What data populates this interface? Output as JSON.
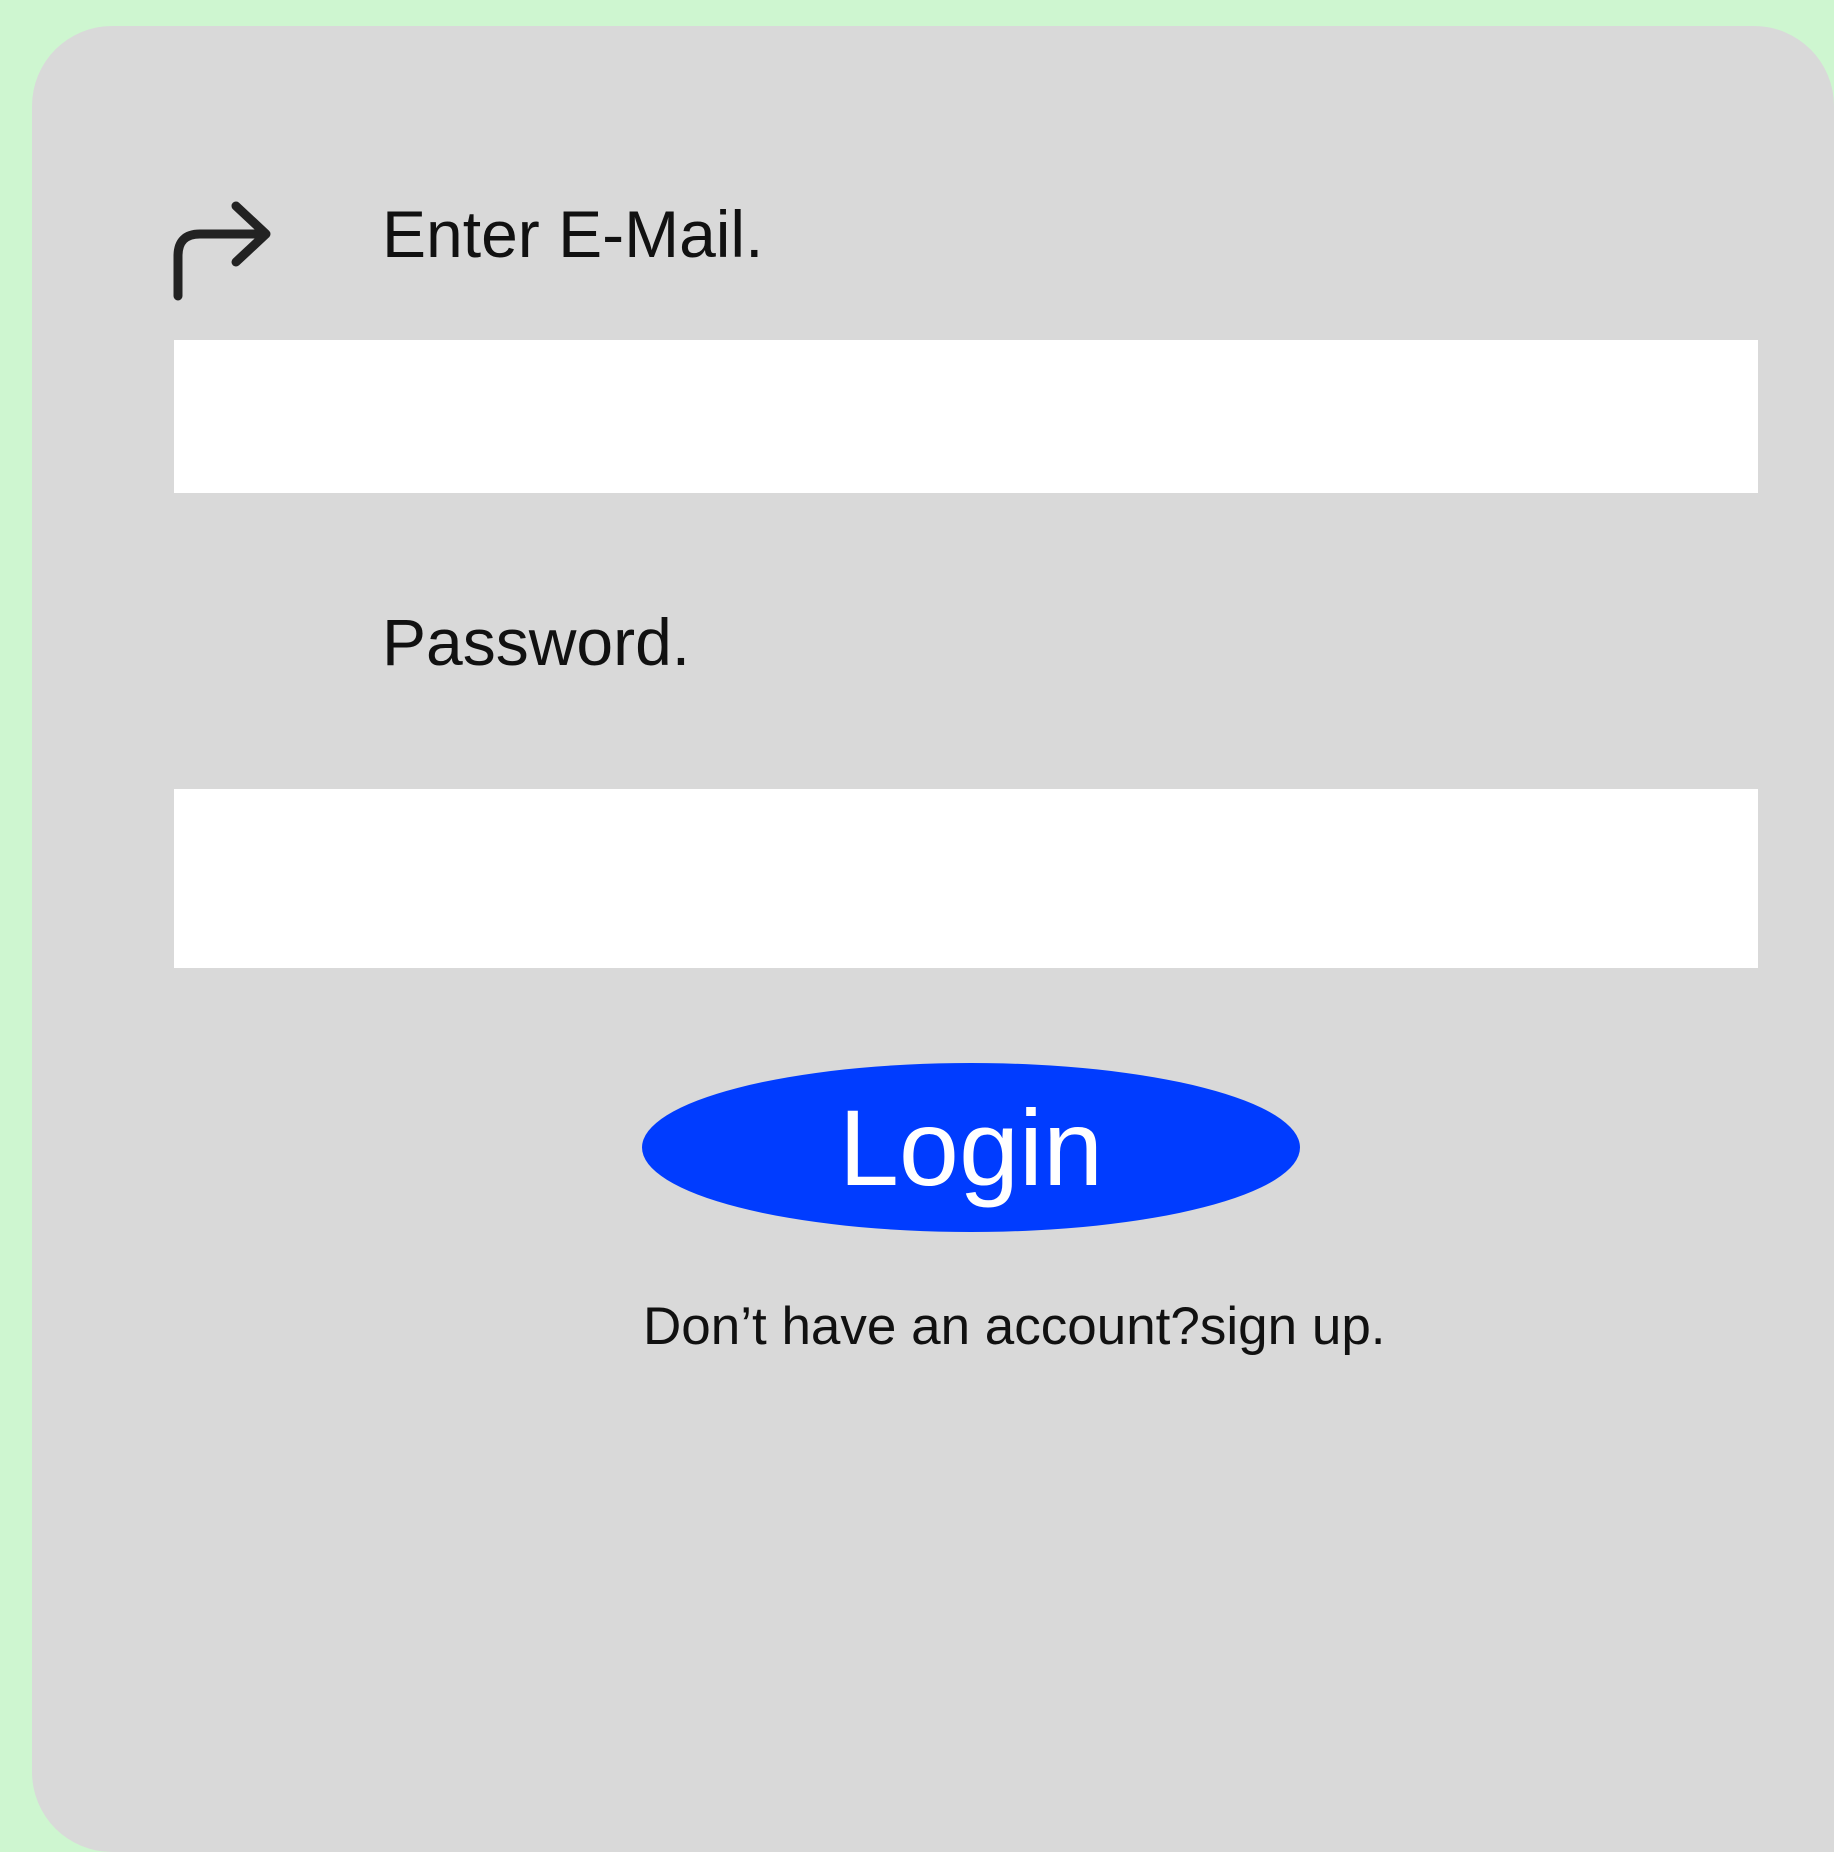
{
  "login_form": {
    "email_label": "Enter E-Mail.",
    "email_value": "",
    "password_label": "Password.",
    "password_value": "",
    "login_button": "Login",
    "signup_prompt": "Don’t have an account?",
    "signup_link": "sign up."
  },
  "icons": {
    "top_left": "arrow-up-right-icon"
  },
  "colors": {
    "page_background": "#cef6d0",
    "card_background": "#d9d9d9",
    "field_background": "#ffffff",
    "login_button_background": "#003cff",
    "login_button_text": "#ffffff",
    "text": "#111111",
    "icon": "#222222"
  }
}
